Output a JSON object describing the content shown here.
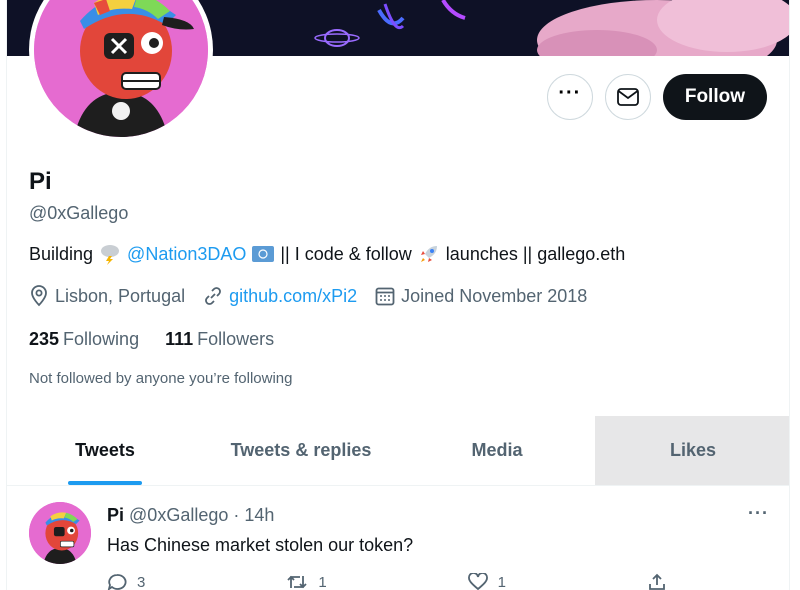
{
  "profile": {
    "name": "Pi",
    "handle": "@0xGallego",
    "bio": {
      "part1": "Building",
      "mention": "@Nation3DAO",
      "part2": "|| I code & follow",
      "part3": "launches || gallego.eth"
    },
    "location": "Lisbon, Portugal",
    "website": "github.com/xPi2",
    "joined": "Joined November 2018",
    "following_count": "235",
    "following_label": "Following",
    "followers_count": "111",
    "followers_label": "Followers",
    "not_followed_note": "Not followed by anyone you’re following"
  },
  "actions": {
    "more_label": "···",
    "follow_label": "Follow"
  },
  "tabs": [
    {
      "label": "Tweets",
      "active": true
    },
    {
      "label": "Tweets & replies",
      "active": false
    },
    {
      "label": "Media",
      "active": false
    },
    {
      "label": "Likes",
      "active": false
    }
  ],
  "tweet": {
    "name": "Pi",
    "handle": "@0xGallego",
    "time": "14h",
    "text": "Has Chinese market stolen our token?",
    "more": "···",
    "replies": "3",
    "retweets": "1",
    "likes": "1"
  },
  "colors": {
    "accent": "#1d9bf0",
    "avatar_bg": "#e56bd0",
    "text": "#0f1419",
    "muted": "#536471"
  },
  "icons": [
    "location-icon",
    "link-icon",
    "calendar-icon",
    "mail-icon",
    "reply-icon",
    "retweet-icon",
    "like-icon",
    "share-icon"
  ]
}
